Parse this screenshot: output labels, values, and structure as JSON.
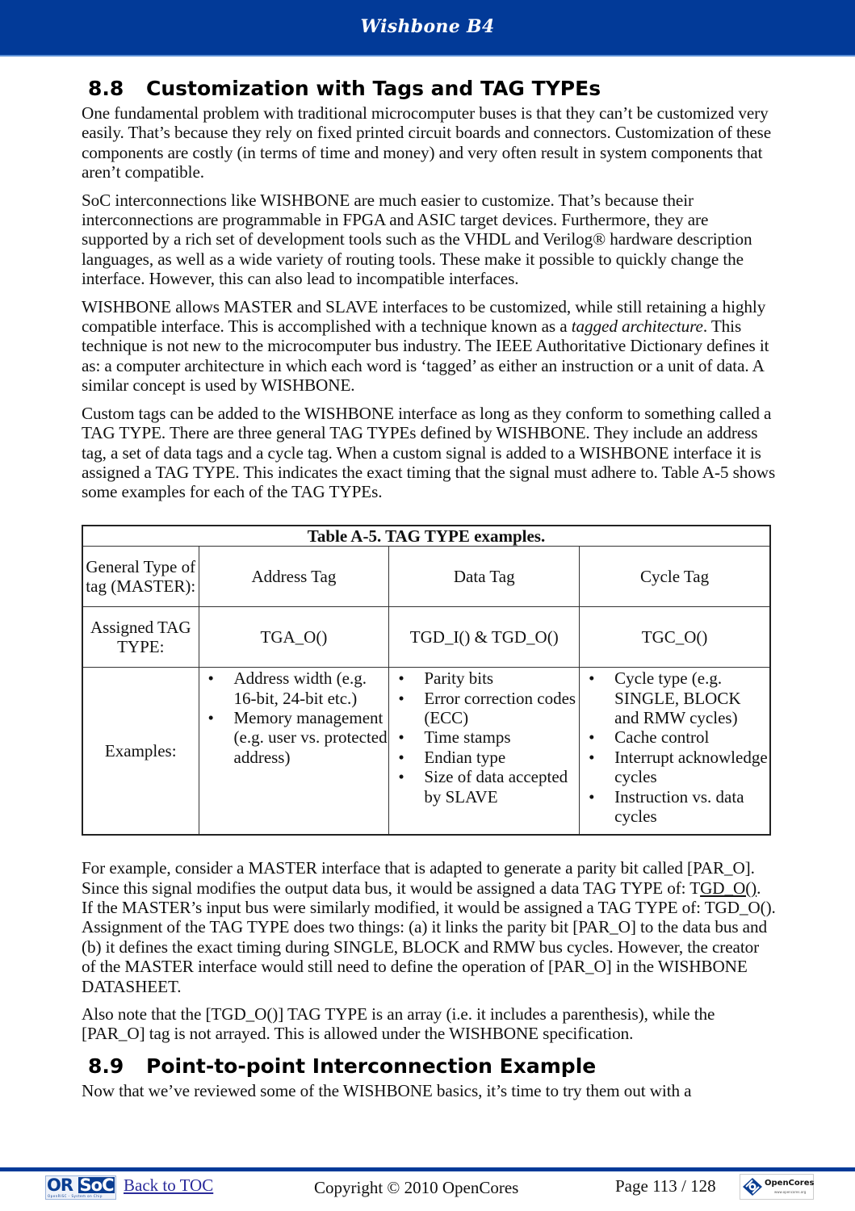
{
  "header": {
    "title": "Wishbone B4"
  },
  "section_8_8": {
    "number": "8.8",
    "title": "Customization with Tags and TAG TYPEs",
    "paragraphs": {
      "p1": "One fundamental problem with traditional microcomputer buses is that they can’t be customized very easily.  That’s because they rely on fixed printed circuit boards and connectors.  Customization of these components are costly (in terms of time and money) and very often result in system components that aren’t compatible.",
      "p2": "SoC interconnections like WISHBONE are much easier to customize.  That’s because their interconnections are programmable in FPGA and ASIC target devices.  Furthermore, they are supported by a rich set of development tools such as the VHDL and Verilog® hardware description languages, as well as a wide variety of routing tools.  These make it possible to quickly change the interface.  However, this can also lead to incompatible interfaces.",
      "p3_before": "WISHBONE allows MASTER and SLAVE interfaces to be customized, while still retaining a highly compatible interface.  This is accomplished with a technique known as a ",
      "p3_italic": "tagged architecture",
      "p3_after": ".  This technique is not new to the microcomputer bus industry.  The IEEE Authoritative Dictionary defines it as: a computer architecture in which each word is ‘tagged’ as either an instruction or a unit of data.  A similar concept is used by WISHBONE.",
      "p4": "Custom tags can be added to the WISHBONE interface as long as they conform to something called a TAG TYPE.  There are three general TAG TYPEs defined by WISHBONE.  They include an address tag, a set of data tags and a cycle tag.  When a custom signal is added to a WISHBONE interface it is assigned a TAG TYPE.  This indicates the exact timing that the signal must adhere to.  Table A-5 shows some examples for each of the TAG TYPEs.",
      "p5_a": "For example, consider a MASTER interface that is adapted to generate a parity bit called [PAR_O].  Since this signal modifies the output data bus, it would be assigned a data TAG TYPE of: T",
      "p5_link": "GD_O()",
      "p5_b": ".  If the MASTER’s input bus were similarly modified, it would be assigned a TAG TYPE of: TGD_O().  Assignment of the TAG TYPE does two things: (a) it links the parity bit [PAR_O] to the data bus and (b) it defines the exact timing during SINGLE, BLOCK and RMW bus cycles.  However, the creator of the MASTER interface would still need to define the operation of [PAR_O] in the WISHBONE DATASHEET.",
      "p6": "Also note that the [TGD_O()] TAG TYPE is an array (i.e. it includes a parenthesis), while the [PAR_O] tag is not arrayed.  This is allowed under the WISHBONE specification."
    }
  },
  "table": {
    "caption": "Table A-5.  TAG TYPE examples.",
    "row_headers": [
      "General Type of tag (MASTER):",
      "Assigned TAG TYPE:",
      "Examples:"
    ],
    "columns": [
      {
        "general_type": "Address Tag",
        "assigned": "TGA_O()",
        "examples": [
          "Address width (e.g. 16-bit, 24-bit etc.)",
          "Memory management (e.g. user vs. protected address)"
        ]
      },
      {
        "general_type": "Data Tag",
        "assigned": "TGD_I() & TGD_O()",
        "examples": [
          "Parity bits",
          "Error correction codes (ECC)",
          "Time stamps",
          "Endian type",
          "Size of data accepted by SLAVE"
        ]
      },
      {
        "general_type": "Cycle Tag",
        "assigned": "TGC_O()",
        "examples": [
          "Cycle type (e.g. SINGLE, BLOCK and RMW cycles)",
          "Cache control",
          "Interrupt acknowledge cycles",
          "Instruction vs. data cycles"
        ]
      }
    ]
  },
  "section_8_9": {
    "number": "8.9",
    "title": "Point-to-point Interconnection Example",
    "p1": "Now that we’ve reviewed some of the WISHBONE basics, it’s time to try them out with a"
  },
  "footer": {
    "orsoc_logo": {
      "left": "OR",
      "right": "SoC",
      "tagline": "OpenRISC  -  System on Chip"
    },
    "back_to_toc": "Back to TOC",
    "copyright": "Copyright © 2010 OpenCores",
    "page": "Page 113 / 128",
    "opencores_logo": {
      "name": "OpenCores",
      "url": "www.opencores.org"
    }
  },
  "colors": {
    "brand_blue": "#023a98",
    "link": "#2a2a9a"
  }
}
